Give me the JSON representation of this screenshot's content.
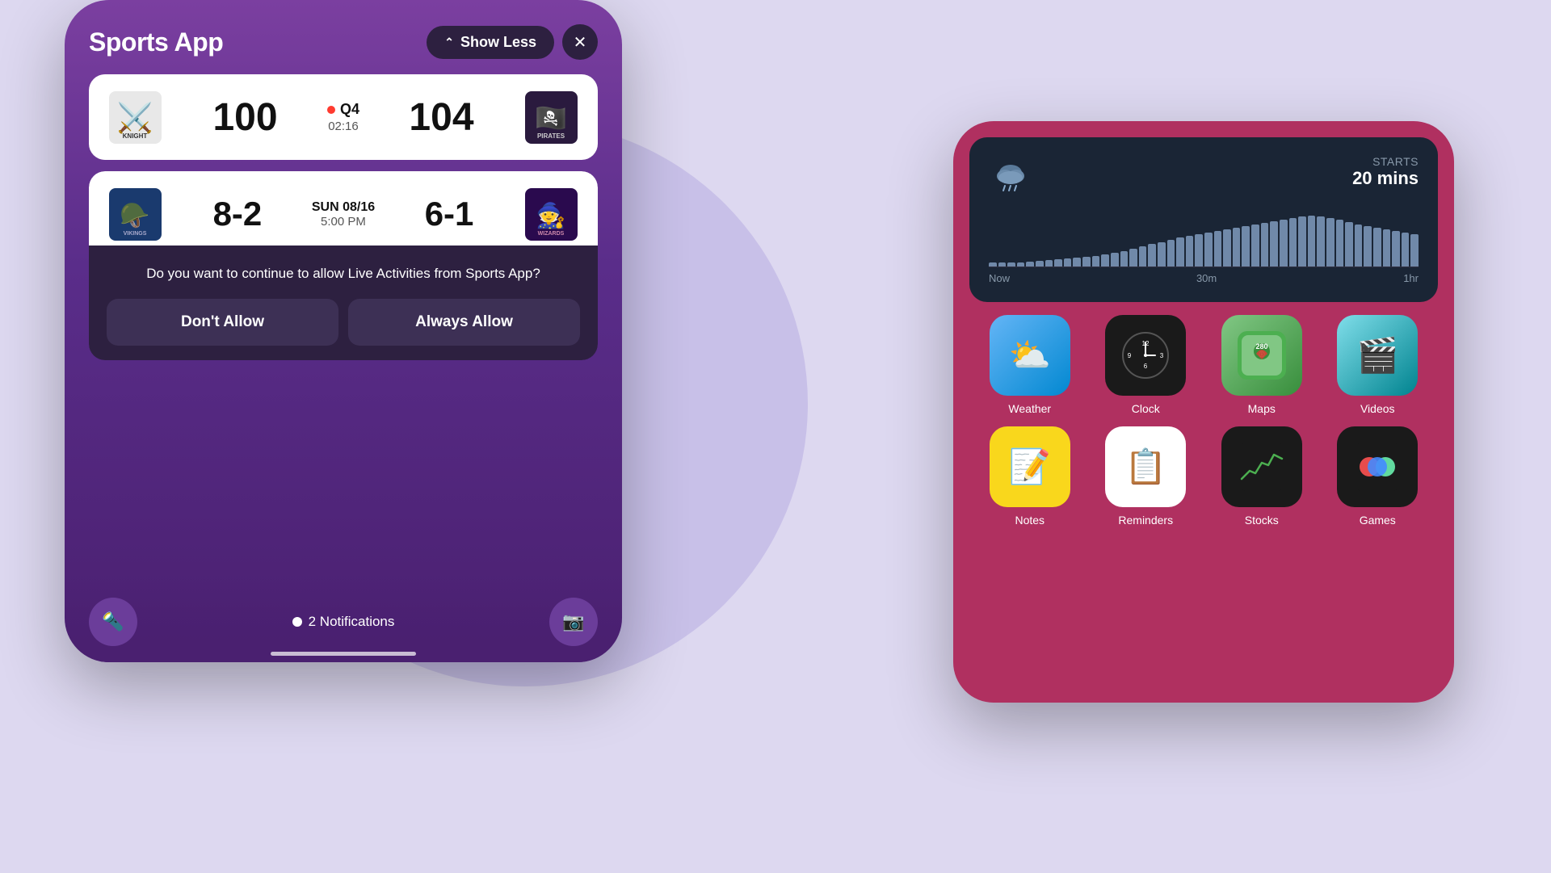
{
  "background": {
    "color": "#ddd8f0"
  },
  "left_phone": {
    "title": "Sports App",
    "show_less_label": "Show Less",
    "close_icon": "✕",
    "game1": {
      "team1_name": "Knights",
      "team1_score": "100",
      "status": "Q4",
      "time": "02:16",
      "team2_score": "104",
      "team2_name": "Pirates"
    },
    "game2": {
      "team1_name": "Vikings",
      "team1_score": "8-2",
      "date": "SUN 08/16",
      "time": "5:00 PM",
      "team2_score": "6-1",
      "team2_name": "Wizards"
    },
    "notification": {
      "text": "Do you want to continue to allow Live Activities from Sports App?",
      "dont_allow": "Don't Allow",
      "always_allow": "Always Allow"
    },
    "bottom": {
      "notifications_count": "2 Notifications"
    }
  },
  "right_phone": {
    "weather_widget": {
      "starts_label": "STARTS",
      "starts_time": "20 mins",
      "chart_label_now": "Now",
      "chart_label_30m": "30m",
      "chart_label_1hr": "1hr"
    },
    "apps_row1": [
      {
        "name": "Weather",
        "icon": "weather"
      },
      {
        "name": "Clock",
        "icon": "clock"
      },
      {
        "name": "Maps",
        "icon": "maps"
      },
      {
        "name": "Videos",
        "icon": "videos"
      }
    ],
    "apps_row2": [
      {
        "name": "Notes",
        "icon": "notes"
      },
      {
        "name": "Reminders",
        "icon": "reminders"
      },
      {
        "name": "Stocks",
        "icon": "stocks"
      },
      {
        "name": "Games",
        "icon": "games"
      }
    ]
  }
}
